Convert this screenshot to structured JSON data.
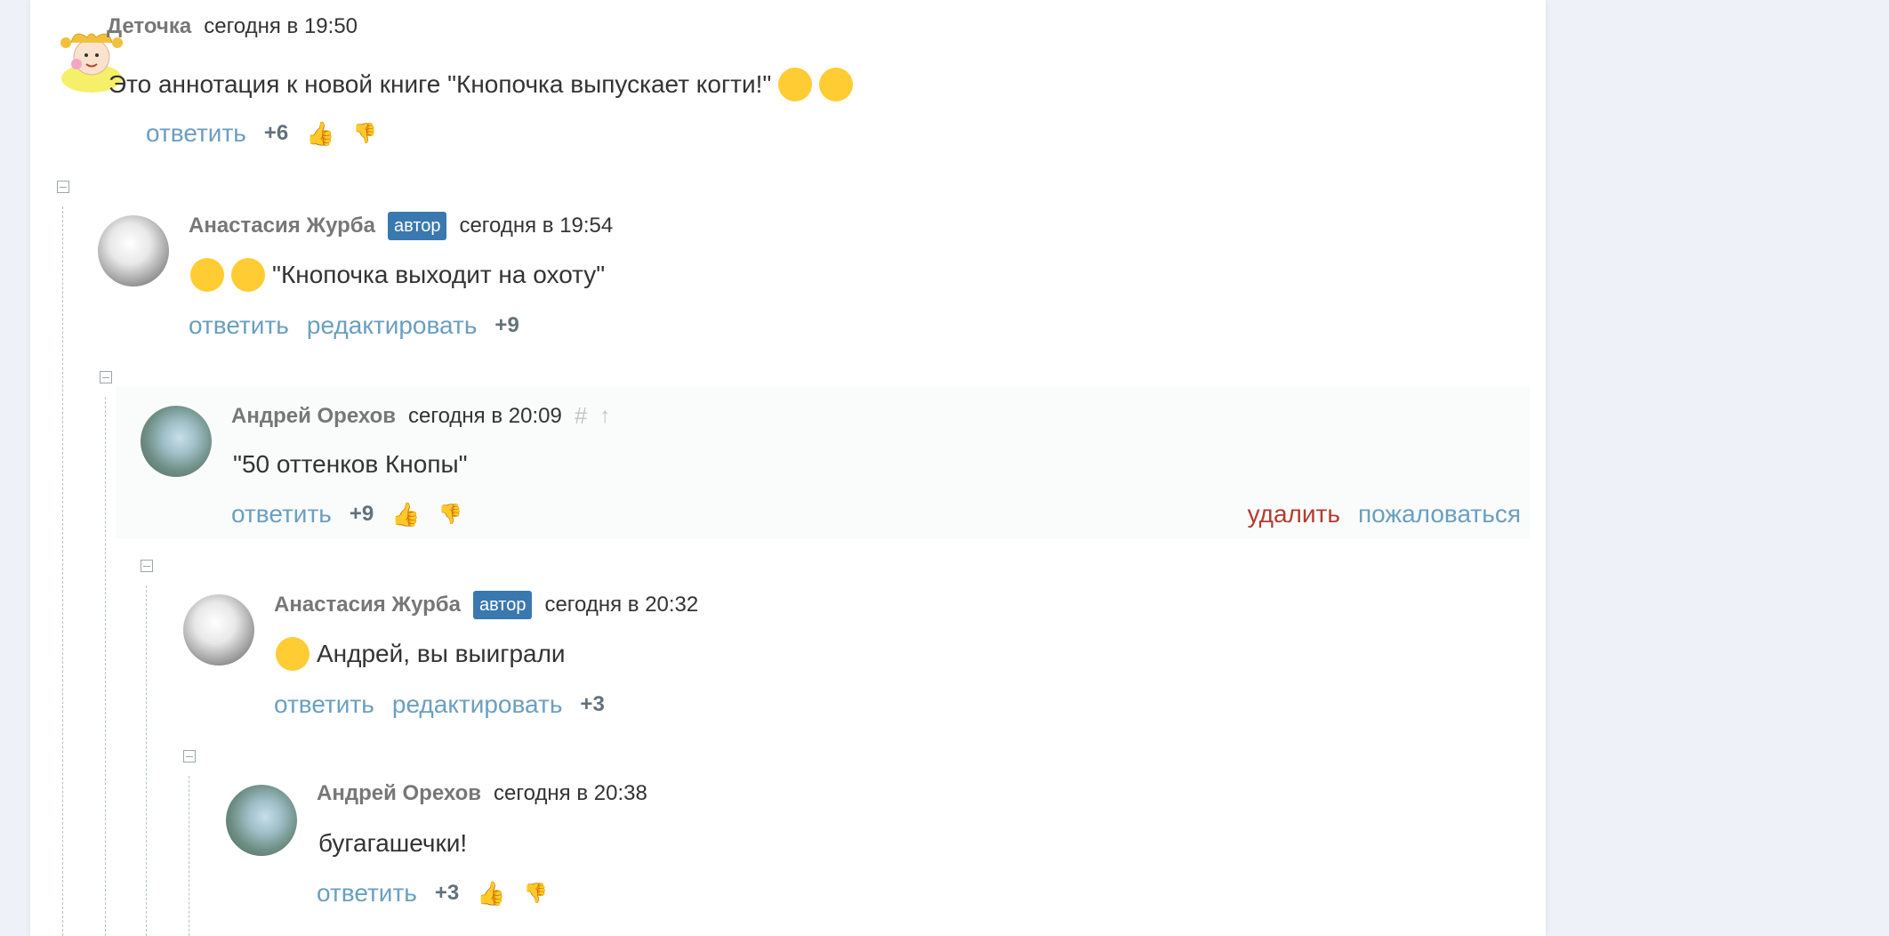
{
  "comments": [
    {
      "author": "Деточка",
      "time": "сегодня в 19:50",
      "text": "Это аннотация к новой книге \"Кнопочка выпускает когти!\"",
      "reply": "ответить",
      "score": "+6"
    },
    {
      "author": "Анастасия Журба",
      "badge": "автор",
      "time": "сегодня в 19:54",
      "text": "\"Кнопочка выходит на охоту\"",
      "reply": "ответить",
      "edit": "редактировать",
      "score": "+9"
    },
    {
      "author": "Андрей Орехов",
      "time": "сегодня в 20:09",
      "hash": "#",
      "text": "\"50 оттенков Кнопы\"",
      "reply": "ответить",
      "score": "+9",
      "delete": "удалить",
      "report": "пожаловаться"
    },
    {
      "author": "Анастасия Журба",
      "badge": "автор",
      "time": "сегодня в 20:32",
      "text": "Андрей, вы выиграли",
      "reply": "ответить",
      "edit": "редактировать",
      "score": "+3"
    },
    {
      "author": "Андрей Орехов",
      "time": "сегодня в 20:38",
      "text": "бугагашечки!",
      "reply": "ответить",
      "score": "+3"
    }
  ],
  "colors": {
    "link": "#6a9fc0",
    "badge": "#3a78b0",
    "delete": "#b33b2e",
    "like": "#7cc243"
  }
}
